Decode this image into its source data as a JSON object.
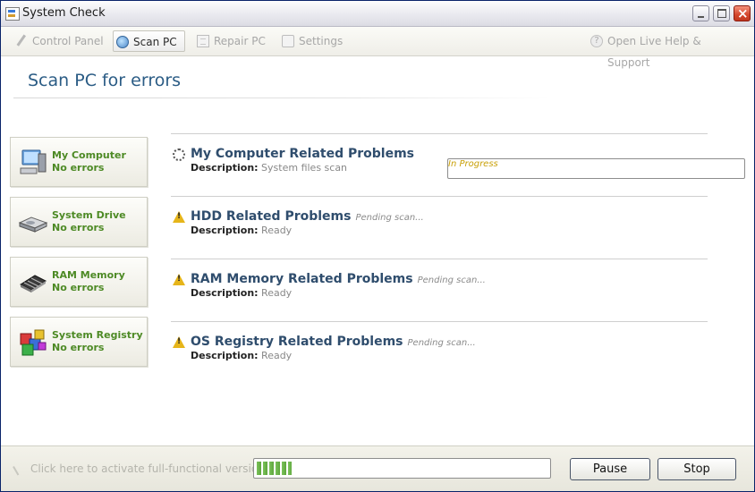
{
  "window": {
    "title": "System Check"
  },
  "toolbar": {
    "items": [
      {
        "label": "Control Panel",
        "icon": "wrench-icon",
        "active": false
      },
      {
        "label": "Scan PC",
        "icon": "scan-icon",
        "active": true
      },
      {
        "label": "Repair PC",
        "icon": "repair-icon",
        "active": false
      },
      {
        "label": "Settings",
        "icon": "settings-icon",
        "active": false
      }
    ],
    "help_label": "Open Live Help & Support"
  },
  "main": {
    "heading": "Scan PC for errors",
    "categories": [
      {
        "name": "My Computer",
        "status": "No errors",
        "icon": "computer-icon"
      },
      {
        "name": "System Drive",
        "status": "No errors",
        "icon": "hard-drive-icon"
      },
      {
        "name": "RAM Memory",
        "status": "No errors",
        "icon": "ram-chip-icon"
      },
      {
        "name": "System Registry",
        "status": "No errors",
        "icon": "registry-icon"
      }
    ],
    "problems": [
      {
        "title": "My Computer Related Problems",
        "status": "In Progress",
        "desc_label": "Description:",
        "desc": "System files scan",
        "icon": "spinner-icon"
      },
      {
        "title": "HDD Related Problems",
        "status": "Pending scan...",
        "desc_label": "Description:",
        "desc": "Ready",
        "icon": "warning-icon"
      },
      {
        "title": "RAM Memory Related Problems",
        "status": "Pending scan...",
        "desc_label": "Description:",
        "desc": "Ready",
        "icon": "warning-icon"
      },
      {
        "title": "OS Registry Related Problems",
        "status": "Pending scan...",
        "desc_label": "Description:",
        "desc": "Ready",
        "icon": "warning-icon"
      }
    ]
  },
  "footer": {
    "activate_label": "Click here to activate full-functional version",
    "progress_fraction": 0.12,
    "pause_label": "Pause",
    "stop_label": "Stop"
  }
}
